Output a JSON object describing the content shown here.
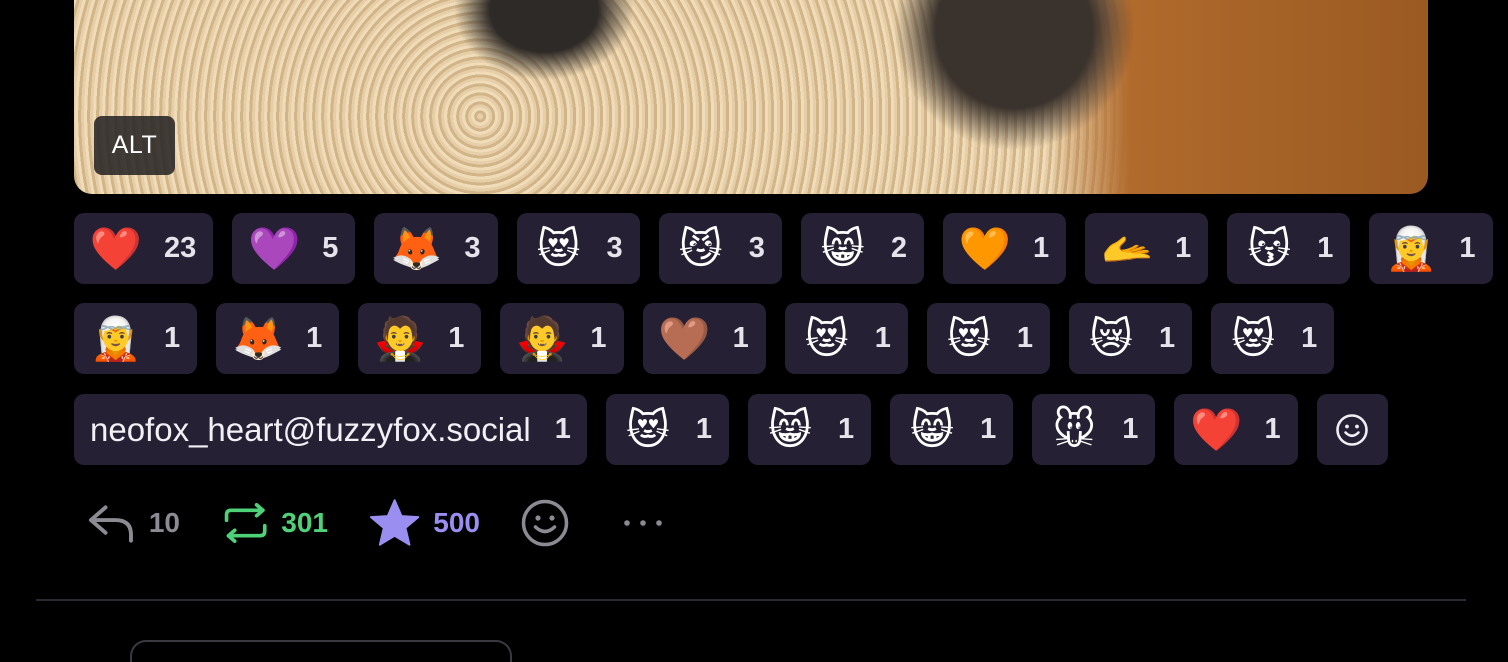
{
  "media": {
    "alt_label": "ALT"
  },
  "reactions": [
    {
      "emoji": "❤️",
      "count": "23",
      "name": "red-heart"
    },
    {
      "emoji": "💜",
      "count": "5",
      "name": "purple-heart"
    },
    {
      "emoji": "🦊",
      "count": "3",
      "name": "neofox-thinking"
    },
    {
      "emoji": "😻",
      "count": "3",
      "name": "neocat-heart-hug"
    },
    {
      "emoji": "😼",
      "count": "3",
      "name": "neocat"
    },
    {
      "emoji": "😸",
      "count": "2",
      "name": "neocat-cook"
    },
    {
      "emoji": "🧡",
      "count": "1",
      "name": "orange-heart"
    },
    {
      "emoji": "🫴",
      "count": "1",
      "name": "hand-emoji"
    },
    {
      "emoji": "😽",
      "count": "1",
      "name": "cat-heart"
    },
    {
      "emoji": "🧝",
      "count": "1",
      "name": "anime-girl"
    },
    {
      "emoji": "🧝",
      "count": "1",
      "name": "anime-girl-2"
    },
    {
      "emoji": "🦊",
      "count": "1",
      "name": "neofox-heart"
    },
    {
      "emoji": "🧛",
      "count": "1",
      "name": "anime-heart"
    },
    {
      "emoji": "🧛",
      "count": "1",
      "name": "anime-heart-2"
    },
    {
      "emoji": "🤎",
      "count": "1",
      "name": "brown-heart"
    },
    {
      "emoji": "😻",
      "count": "1",
      "name": "neocat-hug"
    },
    {
      "emoji": "😻",
      "count": "1",
      "name": "neocat-hug-2"
    },
    {
      "emoji": "😿",
      "count": "1",
      "name": "neofox-cry"
    },
    {
      "emoji": "😻",
      "count": "1",
      "name": "neofox-hug"
    },
    {
      "text": "neofox_heart@fuzzyfox.social",
      "count": "1",
      "name": "remote-reaction"
    },
    {
      "emoji": "😻",
      "count": "1",
      "name": "neofox-hug-2"
    },
    {
      "emoji": "😸",
      "count": "1",
      "name": "neocat-cook-2"
    },
    {
      "emoji": "😸",
      "count": "1",
      "name": "neocat-cook-3"
    },
    {
      "emoji": "🐭",
      "count": "1",
      "name": "mouse"
    },
    {
      "emoji": "❤️",
      "count": "1",
      "name": "heart-creature"
    }
  ],
  "actions": {
    "reply_count": "10",
    "boost_count": "301",
    "favourite_count": "500"
  },
  "colors": {
    "chip_bg": "#252033",
    "boost": "#4fd17a",
    "favourite": "#9a8ef0",
    "muted": "#8c8a92"
  },
  "icons": [
    "reply-icon",
    "boost-icon",
    "star-icon",
    "smiley-icon",
    "more-icon"
  ]
}
